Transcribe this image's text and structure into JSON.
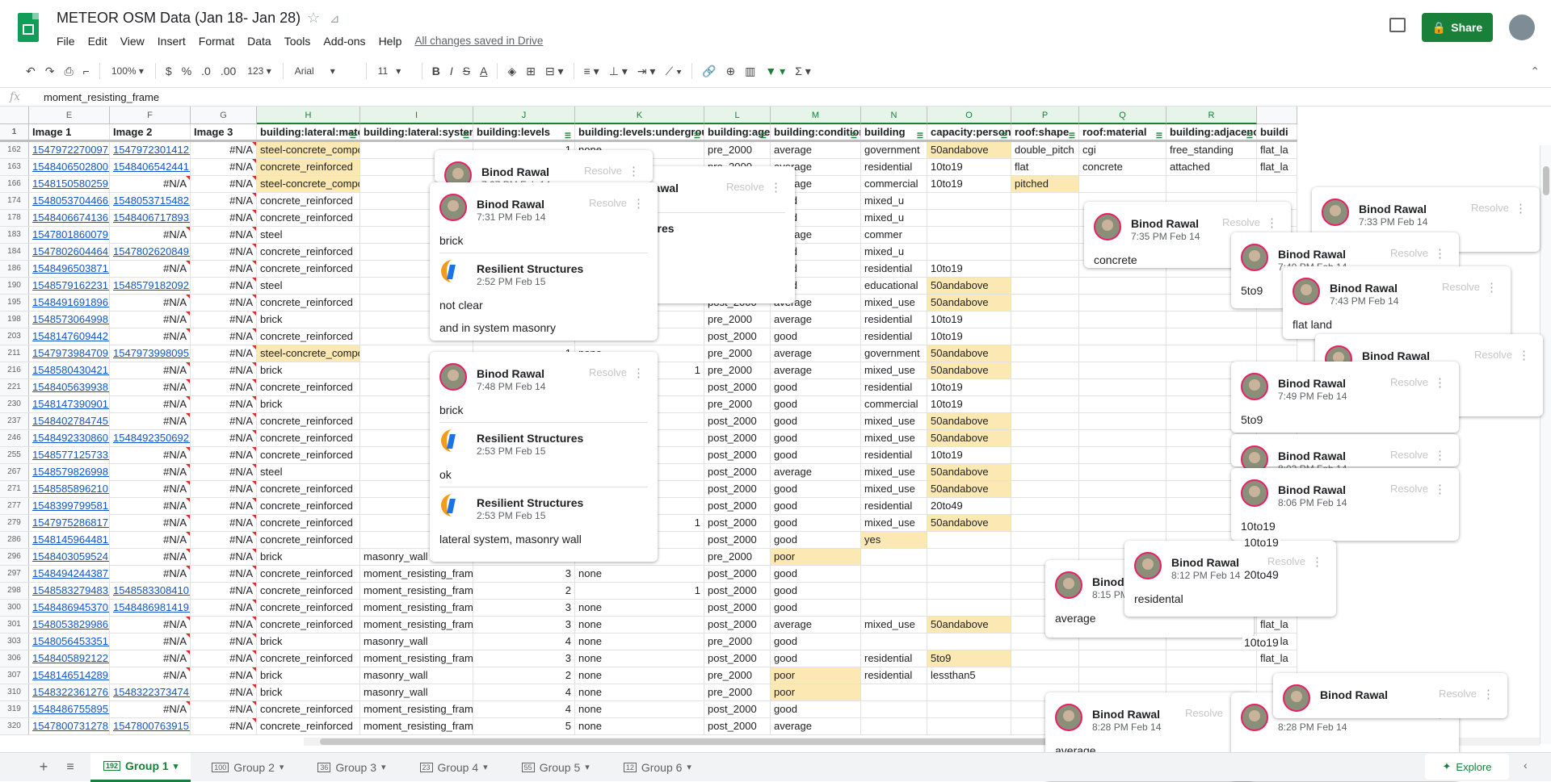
{
  "app": {
    "doc_title": "METEOR OSM Data (Jan 18- Jan 28)",
    "menu": [
      "File",
      "Edit",
      "View",
      "Insert",
      "Format",
      "Data",
      "Tools",
      "Add-ons",
      "Help"
    ],
    "saved_status": "All changes saved in Drive",
    "share_label": "Share",
    "accent_color": "#188038"
  },
  "toolbar": {
    "zoom": "100%",
    "currency": "$",
    "percent": "%",
    "dec_less": ".0",
    "dec_more": ".00",
    "more_formats": "123",
    "font": "Arial",
    "font_size": "11",
    "bold": "B",
    "italic": "I",
    "strike": "S",
    "text_color": "A"
  },
  "formula": {
    "fx": "fx",
    "value": "moment_resisting_frame"
  },
  "grid": {
    "columns": [
      "E",
      "F",
      "G",
      "H",
      "I",
      "J",
      "K",
      "L",
      "M",
      "N",
      "O",
      "P",
      "Q",
      "R",
      ""
    ],
    "header_row_number": "1",
    "headers": [
      "Image 1",
      "Image 2",
      "Image 3",
      "building:lateral:materi",
      "building:lateral:system",
      "building:levels",
      "building:levels:underground",
      "building:age",
      "building:condition",
      "building",
      "capacity:persons",
      "roof:shape",
      "roof:material",
      "building:adjacency",
      "buildi"
    ],
    "rows": [
      {
        "n": "162",
        "e": "1547972270097.",
        "f": "1547972301412.jpg",
        "g": "#N/A",
        "h": "steel-concrete_composite",
        "i": "",
        "j": "1",
        "k": "none",
        "l": "pre_2000",
        "m": "average",
        "nn": "government",
        "o": "50andabove",
        "p": "double_pitch",
        "q": "cgi",
        "r": "free_standing",
        "s": "flat_la"
      },
      {
        "n": "163",
        "e": "1548406502800.",
        "f": "1548406542441.jpg",
        "g": "#N/A",
        "h": "concrete_reinforced",
        "i": "",
        "j": "",
        "k": "",
        "l": "pre_2000",
        "m": "average",
        "nn": "residential",
        "o": "10to19",
        "p": "flat",
        "q": "concrete",
        "r": "attached",
        "s": "flat_la"
      },
      {
        "n": "166",
        "e": "1548150580259.",
        "f": "#N/A",
        "g": "#N/A",
        "h": "steel-concrete_composite",
        "i": "",
        "j": "",
        "k": "",
        "l": "post_2000",
        "m": "average",
        "nn": "commercial",
        "o": "10to19",
        "p": "pitched",
        "q": "",
        "r": "",
        "s": ""
      },
      {
        "n": "174",
        "e": "1548053704466.",
        "f": "1548053715482.jpg",
        "g": "#N/A",
        "h": "concrete_reinforced",
        "i": "",
        "j": "",
        "k": "1",
        "l": "post_2000",
        "m": "good",
        "nn": "mixed_u",
        "o": "",
        "p": "",
        "q": "",
        "r": "",
        "s": ""
      },
      {
        "n": "178",
        "e": "1548406674136.",
        "f": "1548406717893.jpg",
        "g": "#N/A",
        "h": "concrete_reinforced",
        "i": "",
        "j": "",
        "k": "",
        "l": "post_2000",
        "m": "good",
        "nn": "mixed_u",
        "o": "",
        "p": "",
        "q": "",
        "r": "",
        "s": ""
      },
      {
        "n": "183",
        "e": "1547801860079.",
        "f": "#N/A",
        "g": "#N/A",
        "h": "steel",
        "i": "",
        "j": "",
        "k": "",
        "l": "post_2000",
        "m": "average",
        "nn": "commer",
        "o": "",
        "p": "",
        "q": "",
        "r": "",
        "s": ""
      },
      {
        "n": "184",
        "e": "1547802604464.",
        "f": "1547802620849.jpg",
        "g": "#N/A",
        "h": "concrete_reinforced",
        "i": "",
        "j": "",
        "k": "",
        "l": "post_2000",
        "m": "good",
        "nn": "mixed_u",
        "o": "",
        "p": "",
        "q": "",
        "r": "",
        "s": ""
      },
      {
        "n": "186",
        "e": "1548496503871.",
        "f": "#N/A",
        "g": "#N/A",
        "h": "concrete_reinforced",
        "i": "",
        "j": "",
        "k": "",
        "l": "post_2000",
        "m": "good",
        "nn": "residential",
        "o": "10to19",
        "p": "",
        "q": "",
        "r": "",
        "s": ""
      },
      {
        "n": "190",
        "e": "1548579162231.",
        "f": "1548579182092.jpg",
        "g": "#N/A",
        "h": "steel",
        "i": "",
        "j": "",
        "k": "",
        "l": "post_2000",
        "m": "good",
        "nn": "educational",
        "o": "50andabove",
        "p": "",
        "q": "",
        "r": "",
        "s": ""
      },
      {
        "n": "195",
        "e": "1548491691896.",
        "f": "#N/A",
        "g": "#N/A",
        "h": "concrete_reinforced",
        "i": "",
        "j": "3",
        "k": "none",
        "l": "post_2000",
        "m": "average",
        "nn": "mixed_use",
        "o": "50andabove",
        "p": "",
        "q": "",
        "r": "",
        "s": ""
      },
      {
        "n": "198",
        "e": "1548573064998.",
        "f": "#N/A",
        "g": "#N/A",
        "h": "brick",
        "i": "",
        "j": "3",
        "k": "none",
        "l": "pre_2000",
        "m": "average",
        "nn": "residential",
        "o": "10to19",
        "p": "",
        "q": "",
        "r": "",
        "s": ""
      },
      {
        "n": "203",
        "e": "1548147609442.",
        "f": "#N/A",
        "g": "#N/A",
        "h": "concrete_reinforced",
        "i": "",
        "j": "2",
        "k": "none",
        "l": "post_2000",
        "m": "good",
        "nn": "residential",
        "o": "10to19",
        "p": "",
        "q": "",
        "r": "",
        "s": ""
      },
      {
        "n": "211",
        "e": "1547973984709.",
        "f": "1547973998095.jpg",
        "g": "#N/A",
        "h": "steel-concrete_composite",
        "i": "",
        "j": "1",
        "k": "none",
        "l": "pre_2000",
        "m": "average",
        "nn": "government",
        "o": "50andabove",
        "p": "",
        "q": "",
        "r": "",
        "s": ""
      },
      {
        "n": "216",
        "e": "1548580430421.",
        "f": "#N/A",
        "g": "#N/A",
        "h": "brick",
        "i": "",
        "j": "2",
        "k": "1",
        "l": "pre_2000",
        "m": "average",
        "nn": "mixed_use",
        "o": "50andabove",
        "p": "",
        "q": "",
        "r": "",
        "s": ""
      },
      {
        "n": "221",
        "e": "1548405639938.",
        "f": "#N/A",
        "g": "#N/A",
        "h": "concrete_reinforced",
        "i": "",
        "j": "4",
        "k": "none",
        "l": "post_2000",
        "m": "good",
        "nn": "residential",
        "o": "10to19",
        "p": "",
        "q": "",
        "r": "",
        "s": ""
      },
      {
        "n": "230",
        "e": "1548147390901.",
        "f": "#N/A",
        "g": "#N/A",
        "h": "brick",
        "i": "",
        "j": "3",
        "k": "none",
        "l": "pre_2000",
        "m": "good",
        "nn": "commercial",
        "o": "10to19",
        "p": "",
        "q": "",
        "r": "",
        "s": ""
      },
      {
        "n": "237",
        "e": "1548402784745.",
        "f": "#N/A",
        "g": "#N/A",
        "h": "concrete_reinforced",
        "i": "",
        "j": "2",
        "k": "none",
        "l": "post_2000",
        "m": "good",
        "nn": "mixed_use",
        "o": "50andabove",
        "p": "",
        "q": "",
        "r": "",
        "s": ""
      },
      {
        "n": "246",
        "e": "1548492330860.",
        "f": "1548492350692.jpg",
        "g": "#N/A",
        "h": "concrete_reinforced",
        "i": "",
        "j": "3",
        "k": "none",
        "l": "post_2000",
        "m": "good",
        "nn": "mixed_use",
        "o": "50andabove",
        "p": "",
        "q": "",
        "r": "",
        "s": ""
      },
      {
        "n": "255",
        "e": "1548577125733.",
        "f": "#N/A",
        "g": "#N/A",
        "h": "concrete_reinforced",
        "i": "",
        "j": "3",
        "k": "none",
        "l": "post_2000",
        "m": "good",
        "nn": "residential",
        "o": "10to19",
        "p": "",
        "q": "",
        "r": "",
        "s": ""
      },
      {
        "n": "267",
        "e": "1548579826998.",
        "f": "#N/A",
        "g": "#N/A",
        "h": "steel",
        "i": "",
        "j": "2",
        "k": "none",
        "l": "post_2000",
        "m": "average",
        "nn": "mixed_use",
        "o": "50andabove",
        "p": "",
        "q": "",
        "r": "",
        "s": "flat_la"
      },
      {
        "n": "271",
        "e": "1548585896210.",
        "f": "#N/A",
        "g": "#N/A",
        "h": "concrete_reinforced",
        "i": "",
        "j": "4",
        "k": "none",
        "l": "post_2000",
        "m": "good",
        "nn": "mixed_use",
        "o": "50andabove",
        "p": "",
        "q": "",
        "r": "",
        "s": "flat_la"
      },
      {
        "n": "277",
        "e": "1548399799581.",
        "f": "#N/A",
        "g": "#N/A",
        "h": "concrete_reinforced",
        "i": "",
        "j": "6",
        "k": "none",
        "l": "post_2000",
        "m": "good",
        "nn": "residential",
        "o": "20to49",
        "p": "",
        "q": "",
        "r": "",
        "s": ""
      },
      {
        "n": "279",
        "e": "1547975286817.",
        "f": "#N/A",
        "g": "#N/A",
        "h": "concrete_reinforced",
        "i": "",
        "j": "4",
        "k": "1",
        "l": "post_2000",
        "m": "good",
        "nn": "mixed_use",
        "o": "50andabove",
        "p": "",
        "q": "",
        "r": "",
        "s": ""
      },
      {
        "n": "286",
        "e": "1548145964481.",
        "f": "#N/A",
        "g": "#N/A",
        "h": "concrete_reinforced",
        "i": "",
        "j": "1",
        "k": "none",
        "l": "post_2000",
        "m": "good",
        "nn": "yes",
        "o": "",
        "p": "",
        "q": "",
        "r": "",
        "s": "flat_la"
      },
      {
        "n": "296",
        "e": "1548403059524.",
        "f": "#N/A",
        "g": "#N/A",
        "h": "brick",
        "i": "masonry_wall",
        "j": "4",
        "k": "none",
        "l": "pre_2000",
        "m": "poor",
        "nn": "",
        "o": "",
        "p": "",
        "q": "",
        "r": "",
        "s": "flat_la"
      },
      {
        "n": "297",
        "e": "1548494244387.",
        "f": "#N/A",
        "g": "#N/A",
        "h": "concrete_reinforced",
        "i": "moment_resisting_frame",
        "j": "3",
        "k": "none",
        "l": "post_2000",
        "m": "good",
        "nn": "",
        "o": "",
        "p": "",
        "q": "",
        "r": "",
        "s": "flat_la"
      },
      {
        "n": "298",
        "e": "1548583279483.",
        "f": "1548583308410.jpg",
        "g": "#N/A",
        "h": "concrete_reinforced",
        "i": "moment_resisting_frame",
        "j": "2",
        "k": "1",
        "l": "post_2000",
        "m": "good",
        "nn": "",
        "o": "",
        "p": "",
        "q": "",
        "r": "",
        "s": "flat_la"
      },
      {
        "n": "300",
        "e": "1548486945370.",
        "f": "1548486981419.jpg",
        "g": "#N/A",
        "h": "concrete_reinforced",
        "i": "moment_resisting_frame",
        "j": "3",
        "k": "none",
        "l": "post_2000",
        "m": "good",
        "nn": "",
        "o": "",
        "p": "",
        "q": "",
        "r": "",
        "s": "flat_la"
      },
      {
        "n": "301",
        "e": "1548053829986.",
        "f": "#N/A",
        "g": "#N/A",
        "h": "concrete_reinforced",
        "i": "moment_resisting_frame",
        "j": "3",
        "k": "none",
        "l": "post_2000",
        "m": "average",
        "nn": "mixed_use",
        "o": "50andabove",
        "p": "",
        "q": "",
        "r": "",
        "s": "flat_la"
      },
      {
        "n": "303",
        "e": "1548056453351.",
        "f": "#N/A",
        "g": "#N/A",
        "h": "brick",
        "i": "masonry_wall",
        "j": "4",
        "k": "none",
        "l": "pre_2000",
        "m": "good",
        "nn": "",
        "o": "",
        "p": "",
        "q": "",
        "r": "",
        "s": "flat_la"
      },
      {
        "n": "306",
        "e": "1548405892122.",
        "f": "#N/A",
        "g": "#N/A",
        "h": "concrete_reinforced",
        "i": "moment_resisting_frame",
        "j": "3",
        "k": "none",
        "l": "post_2000",
        "m": "good",
        "nn": "residential",
        "o": "5to9",
        "p": "",
        "q": "",
        "r": "",
        "s": "flat_la"
      },
      {
        "n": "307",
        "e": "1548146514289.",
        "f": "#N/A",
        "g": "#N/A",
        "h": "brick",
        "i": "masonry_wall",
        "j": "2",
        "k": "none",
        "l": "pre_2000",
        "m": "poor",
        "nn": "residential",
        "o": "lessthan5",
        "p": "",
        "q": "",
        "r": "",
        "s": ""
      },
      {
        "n": "310",
        "e": "1548322361276.",
        "f": "1548322373474.jpg",
        "g": "#N/A",
        "h": "brick",
        "i": "masonry_wall",
        "j": "4",
        "k": "none",
        "l": "pre_2000",
        "m": "poor",
        "nn": "",
        "o": "",
        "p": "",
        "q": "",
        "r": "",
        "s": ""
      },
      {
        "n": "319",
        "e": "1548486755895.",
        "f": "#N/A",
        "g": "#N/A",
        "h": "concrete_reinforced",
        "i": "moment_resisting_frame",
        "j": "4",
        "k": "none",
        "l": "post_2000",
        "m": "good",
        "nn": "",
        "o": "",
        "p": "",
        "q": "",
        "r": "",
        "s": ""
      },
      {
        "n": "320",
        "e": "1547800731278.",
        "f": "1547800763915.jpg",
        "g": "#N/A",
        "h": "concrete_reinforced",
        "i": "moment_resisting_frame",
        "j": "5",
        "k": "none",
        "l": "post_2000",
        "m": "average",
        "nn": "",
        "o": "",
        "p": "",
        "q": "",
        "r": "",
        "s": ""
      }
    ]
  },
  "comments": {
    "resolve": "Resolve",
    "items": [
      {
        "id": "c1",
        "entries": [
          {
            "name": "Binod Rawal",
            "time": "7:27 PM Feb 14",
            "text": ""
          }
        ]
      },
      {
        "id": "c2",
        "entries": [
          {
            "name": "Binod Rawal",
            "time": "7:31 PM Feb 14",
            "text": "brick"
          },
          {
            "name": "Resilient Structures",
            "time": "2:52 PM Feb 15",
            "text": "not clear"
          }
        ],
        "extra": "and in system masonry"
      },
      {
        "id": "c3",
        "entries": [
          {
            "name": "Binod Rawal",
            "time": "Feb 14",
            "text": ""
          },
          {
            "name": "t Structures",
            "time": "Feb 15",
            "text": ""
          }
        ]
      },
      {
        "id": "c4",
        "entries": [
          {
            "name": "Binod Rawal",
            "time": "7:48 PM Feb 14",
            "text": "brick"
          },
          {
            "name": "Resilient Structures",
            "time": "2:53 PM Feb 15",
            "text": "ok"
          },
          {
            "name": "Resilient Structures",
            "time": "2:53 PM Feb 15",
            "text": "lateral system, masonry wall"
          }
        ]
      },
      {
        "id": "c5",
        "entries": [
          {
            "name": "Binod Rawal",
            "time": "7:35 PM Feb 14",
            "text": "concrete"
          }
        ]
      },
      {
        "id": "c6",
        "entries": [
          {
            "name": "Binod Rawal",
            "time": "7:33 PM Feb 14",
            "text": ""
          }
        ]
      },
      {
        "id": "c7",
        "entries": [
          {
            "name": "Binod Rawal",
            "time": "7:40 PM Feb 14",
            "text": "5to9"
          }
        ]
      },
      {
        "id": "c8",
        "entries": [
          {
            "name": "Binod Rawal",
            "time": "7:43 PM Feb 14",
            "text": "flat land"
          }
        ]
      },
      {
        "id": "c9",
        "entries": [
          {
            "name": "Binod Rawal",
            "time": "7:47 PM Feb 14",
            "text": "monopitch"
          }
        ]
      },
      {
        "id": "c10",
        "entries": [
          {
            "name": "Binod Rawal",
            "time": "7:49 PM Feb 14",
            "text": "5to9"
          }
        ]
      },
      {
        "id": "c11",
        "entries": [
          {
            "name": "Binod Rawal",
            "time": "8:03 PM Feb 14",
            "text": ""
          }
        ]
      },
      {
        "id": "c12",
        "entries": [
          {
            "name": "Binod Rawal",
            "time": "8:06 PM Feb 14",
            "text": "10to19"
          }
        ]
      },
      {
        "id": "c13",
        "entries": [
          {
            "name": "Binod Rawal",
            "time": "8:12 PM Feb 14",
            "text": "residental"
          }
        ]
      },
      {
        "id": "c14",
        "entries": [
          {
            "name": "Binod Rawal",
            "time": "8:15 PM Feb 14",
            "text": "average"
          }
        ]
      },
      {
        "id": "c15",
        "entries": [
          {
            "name": "Binod Rawal",
            "time": "8:28 PM Feb 14",
            "text": "average"
          }
        ]
      },
      {
        "id": "c16",
        "entries": [
          {
            "name": "Binod Rawal",
            "time": "8:28 PM Feb 14",
            "text": ""
          }
        ]
      },
      {
        "id": "c17",
        "entries": [
          {
            "name": "Binod Rawal",
            "time": "",
            "text": ""
          }
        ]
      }
    ],
    "fragments": {
      "f1": "10to19",
      "f2": "20to49",
      "f3": "10to19"
    }
  },
  "tabs": [
    {
      "label": "Group 1",
      "count": "192",
      "active": true
    },
    {
      "label": "Group 2",
      "count": "100"
    },
    {
      "label": "Group 3",
      "count": "36"
    },
    {
      "label": "Group 4",
      "count": "23"
    },
    {
      "label": "Group 5",
      "count": "55"
    },
    {
      "label": "Group 6",
      "count": "12"
    }
  ],
  "explore_label": "Explore"
}
